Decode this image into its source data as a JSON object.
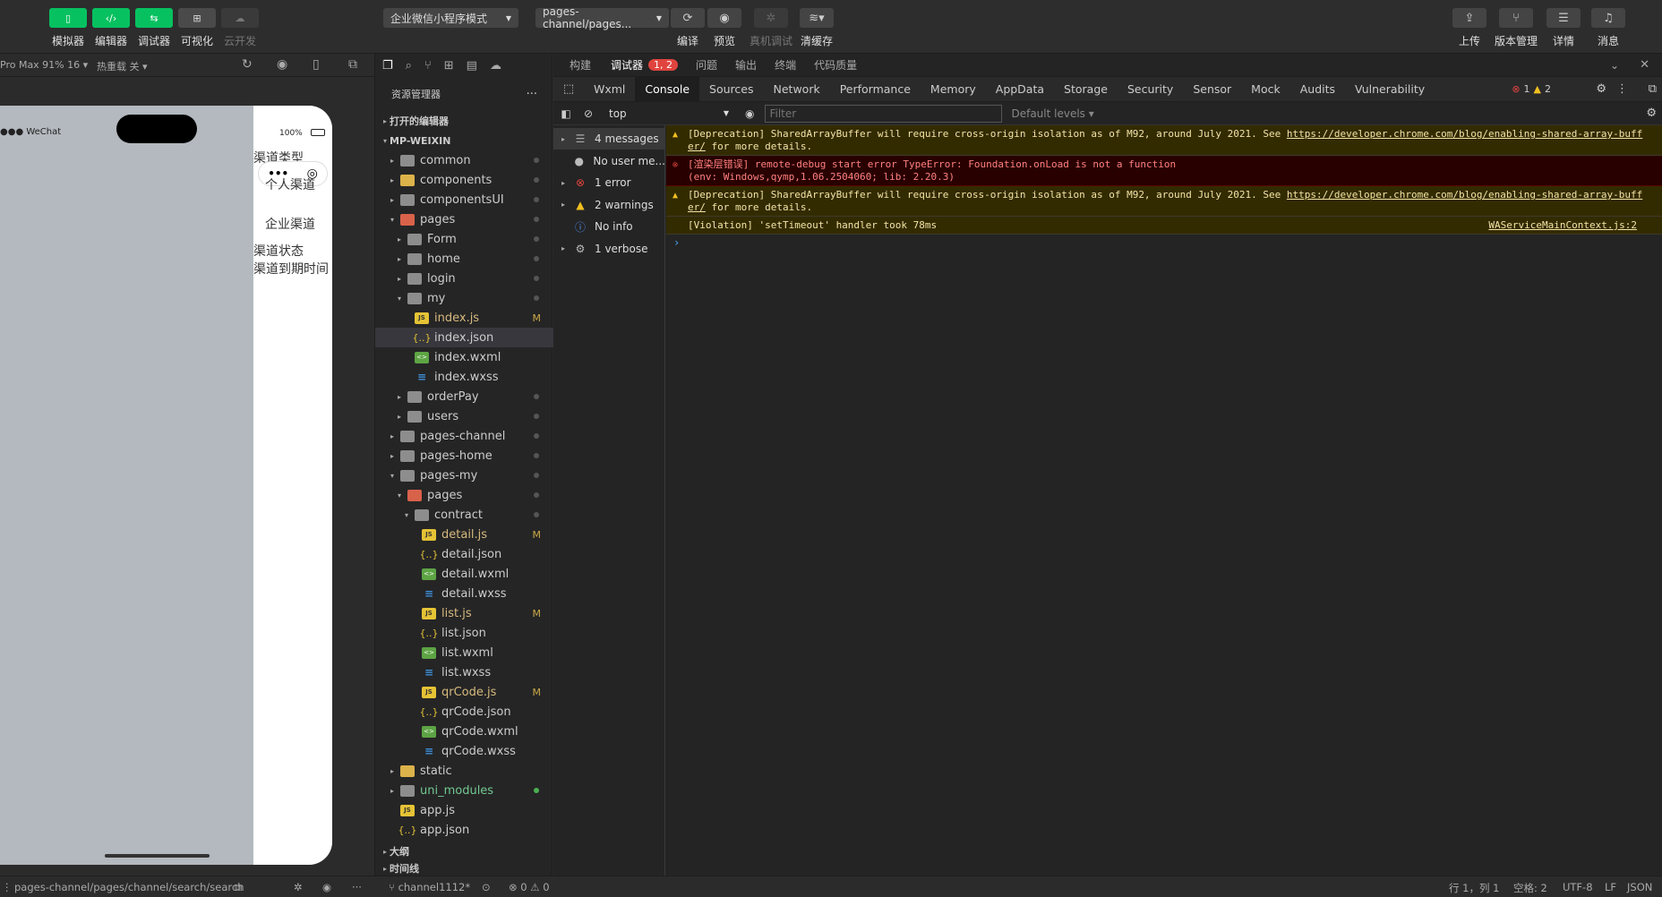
{
  "toolbar": {
    "left_buttons": [
      {
        "label": "模拟器"
      },
      {
        "label": "编辑器"
      },
      {
        "label": "调试器"
      },
      {
        "label": "可视化"
      },
      {
        "label": "云开发"
      }
    ],
    "mode_select": "企业微信小程序模式",
    "page_select": "pages-channel/pages...",
    "center_buttons": [
      {
        "label": "编译"
      },
      {
        "label": "预览"
      },
      {
        "label": "真机调试"
      },
      {
        "label": "清缓存"
      }
    ],
    "right_buttons": [
      {
        "label": "上传"
      },
      {
        "label": "版本管理"
      },
      {
        "label": "详情"
      },
      {
        "label": "消息"
      }
    ]
  },
  "simulator": {
    "device": "Pro Max 91% 16",
    "hot_reload": "热重载 关",
    "status_left": "●●● WeChat",
    "status_right": "100%",
    "texts": [
      "渠道类型",
      "个人渠道",
      "企业渠道",
      "渠道状态",
      "渠道到期时间"
    ]
  },
  "explorer": {
    "title": "资源管理器",
    "open_editors": "打开的编辑器",
    "root": "MP-WEIXIN",
    "outline": "大纲",
    "timeline": "时间线",
    "tree": [
      {
        "name": "common",
        "depth": 1,
        "type": "folder",
        "arrow": "▸",
        "dot": true
      },
      {
        "name": "components",
        "depth": 1,
        "type": "folder-y",
        "arrow": "▸",
        "dot": true
      },
      {
        "name": "componentsUI",
        "depth": 1,
        "type": "folder",
        "arrow": "▸",
        "dot": true
      },
      {
        "name": "pages",
        "depth": 1,
        "type": "folder-r",
        "arrow": "▾",
        "dot": true
      },
      {
        "name": "Form",
        "depth": 2,
        "type": "folder",
        "arrow": "▸",
        "dot": true
      },
      {
        "name": "home",
        "depth": 2,
        "type": "folder",
        "arrow": "▸",
        "dot": true
      },
      {
        "name": "login",
        "depth": 2,
        "type": "folder",
        "arrow": "▸",
        "dot": true
      },
      {
        "name": "my",
        "depth": 2,
        "type": "folder",
        "arrow": "▾",
        "dot": true
      },
      {
        "name": "index.js",
        "depth": 3,
        "type": "js",
        "badge": "M"
      },
      {
        "name": "index.json",
        "depth": 3,
        "type": "json",
        "selected": true
      },
      {
        "name": "index.wxml",
        "depth": 3,
        "type": "wxml"
      },
      {
        "name": "index.wxss",
        "depth": 3,
        "type": "wxss"
      },
      {
        "name": "orderPay",
        "depth": 2,
        "type": "folder",
        "arrow": "▸",
        "dot": true
      },
      {
        "name": "users",
        "depth": 2,
        "type": "folder",
        "arrow": "▸",
        "dot": true
      },
      {
        "name": "pages-channel",
        "depth": 1,
        "type": "folder",
        "arrow": "▸",
        "dot": true
      },
      {
        "name": "pages-home",
        "depth": 1,
        "type": "folder",
        "arrow": "▸",
        "dot": true
      },
      {
        "name": "pages-my",
        "depth": 1,
        "type": "folder",
        "arrow": "▾",
        "dot": true
      },
      {
        "name": "pages",
        "depth": 2,
        "type": "folder-r",
        "arrow": "▾",
        "dot": true
      },
      {
        "name": "contract",
        "depth": 3,
        "type": "folder",
        "arrow": "▾",
        "dot": true
      },
      {
        "name": "detail.js",
        "depth": 4,
        "type": "js",
        "badge": "M"
      },
      {
        "name": "detail.json",
        "depth": 4,
        "type": "json"
      },
      {
        "name": "detail.wxml",
        "depth": 4,
        "type": "wxml"
      },
      {
        "name": "detail.wxss",
        "depth": 4,
        "type": "wxss"
      },
      {
        "name": "list.js",
        "depth": 4,
        "type": "js",
        "badge": "M"
      },
      {
        "name": "list.json",
        "depth": 4,
        "type": "json"
      },
      {
        "name": "list.wxml",
        "depth": 4,
        "type": "wxml"
      },
      {
        "name": "list.wxss",
        "depth": 4,
        "type": "wxss"
      },
      {
        "name": "qrCode.js",
        "depth": 4,
        "type": "js",
        "badge": "M"
      },
      {
        "name": "qrCode.json",
        "depth": 4,
        "type": "json"
      },
      {
        "name": "qrCode.wxml",
        "depth": 4,
        "type": "wxml"
      },
      {
        "name": "qrCode.wxss",
        "depth": 4,
        "type": "wxss"
      },
      {
        "name": "static",
        "depth": 1,
        "type": "folder-y",
        "arrow": "▸"
      },
      {
        "name": "uni_modules",
        "depth": 1,
        "type": "folder",
        "arrow": "▸",
        "dot": true,
        "green": true
      },
      {
        "name": "app.js",
        "depth": 1,
        "type": "js"
      },
      {
        "name": "app.json",
        "depth": 1,
        "type": "json"
      }
    ]
  },
  "devtools": {
    "top_tabs": [
      "构建",
      "调试器",
      "问题",
      "输出",
      "终端",
      "代码质量"
    ],
    "debugger_badge": "1, 2",
    "panel_tabs": [
      "Wxml",
      "Console",
      "Sources",
      "Network",
      "Performance",
      "Memory",
      "AppData",
      "Storage",
      "Security",
      "Sensor",
      "Mock",
      "Audits",
      "Vulnerability"
    ],
    "active_tab": "Console",
    "error_count": "1",
    "warn_count": "2",
    "context": "top",
    "filter_placeholder": "Filter",
    "levels": "Default levels",
    "sidebar": [
      {
        "label": "4 messages",
        "icon": "list-icon",
        "selected": true
      },
      {
        "label": "No user me...",
        "icon": "user-icon"
      },
      {
        "label": "1 error",
        "icon": "error-icon"
      },
      {
        "label": "2 warnings",
        "icon": "warning-icon"
      },
      {
        "label": "No info",
        "icon": "info-icon"
      },
      {
        "label": "1 verbose",
        "icon": "gear-icon"
      }
    ],
    "messages": [
      {
        "level": "warn",
        "line1": "[Deprecation] SharedArrayBuffer will require cross-origin isolation as of M92, around July 2021. See ",
        "link": "https://developer.chrome.com/blog/enabling-shared-array-buff",
        "line2_link": "er/",
        "line2": " for more details."
      },
      {
        "level": "error",
        "line1": "[渲染层错误] remote-debug start error TypeError: Foundation.onLoad is not a function",
        "line2": "(env: Windows,qymp,1.06.2504060; lib: 2.20.3)"
      },
      {
        "level": "warn",
        "line1": "[Deprecation] SharedArrayBuffer will require cross-origin isolation as of M92, around July 2021. See ",
        "link": "https://developer.chrome.com/blog/enabling-shared-array-buff",
        "line2_link": "er/",
        "line2": " for more details."
      },
      {
        "level": "violation",
        "line1": "[Violation] 'setTimeout' handler took 78ms",
        "source": "WAServiceMainContext.js:2"
      }
    ]
  },
  "statusbar": {
    "path": "pages-channel/pages/channel/search/search",
    "branch": "channel1112*",
    "errors": "0",
    "warnings": "0",
    "position": "行 1，列 1",
    "spaces": "空格: 2",
    "encoding": "UTF-8",
    "eol": "LF",
    "language": "JSON"
  }
}
